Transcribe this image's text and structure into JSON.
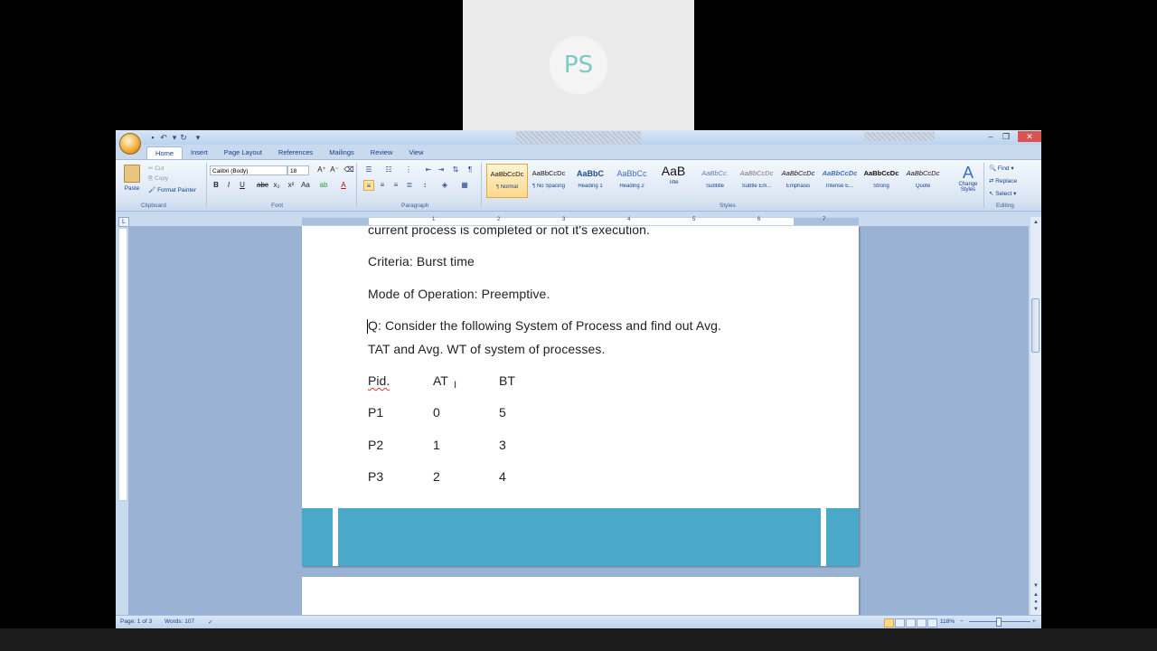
{
  "avatar": {
    "initials": "PS"
  },
  "window": {
    "tabs": [
      "Home",
      "Insert",
      "Page Layout",
      "References",
      "Mailings",
      "Review",
      "View"
    ],
    "clipboard": {
      "paste": "Paste",
      "cut": "Cut",
      "copy": "Copy",
      "format_painter": "Format Painter",
      "label": "Clipboard"
    },
    "font": {
      "name": "Calibri (Body)",
      "size": "18",
      "label": "Font"
    },
    "paragraph": {
      "label": "Paragraph"
    },
    "styles": {
      "label": "Styles",
      "items": [
        {
          "sample": "AaBbCcDc",
          "name": "¶ Normal"
        },
        {
          "sample": "AaBbCcDc",
          "name": "¶ No Spacing"
        },
        {
          "sample": "AaBbC",
          "name": "Heading 1"
        },
        {
          "sample": "AaBbCc",
          "name": "Heading 2"
        },
        {
          "sample": "AaB",
          "name": "Title"
        },
        {
          "sample": "AaBbCc.",
          "name": "Subtitle"
        },
        {
          "sample": "AaBbCcDc",
          "name": "Subtle Em..."
        },
        {
          "sample": "AaBbCcDc",
          "name": "Emphasis"
        },
        {
          "sample": "AaBbCcDc",
          "name": "Intense E..."
        },
        {
          "sample": "AaBbCcDc",
          "name": "Strong"
        },
        {
          "sample": "AaBbCcDc",
          "name": "Quote"
        }
      ],
      "change_styles": "Change Styles"
    },
    "editing": {
      "find": "Find",
      "replace": "Replace",
      "select": "Select",
      "label": "Editing"
    }
  },
  "ruler": {
    "numbers": [
      "1",
      "2",
      "3",
      "4",
      "5",
      "6",
      "7"
    ]
  },
  "document": {
    "line_top": "current process is completed or not it's execution.",
    "criteria": "Criteria: Burst time",
    "mode": "Mode of Operation: Preemptive.",
    "question_1": "Q: Consider the following System of Process and find out Avg.",
    "question_2": "TAT and Avg. WT of system of processes.",
    "table": {
      "headers": [
        "Pid.",
        "AT",
        "BT"
      ],
      "rows": [
        [
          "P1",
          "0",
          "5"
        ],
        [
          "P2",
          "1",
          "3"
        ],
        [
          "P3",
          "2",
          "4"
        ]
      ]
    }
  },
  "statusbar": {
    "page": "Page: 1 of 3",
    "words": "Words: 107",
    "zoom": "118%"
  },
  "colors": {
    "page_band": "#4aa8c8",
    "ribbon_text": "#15428b",
    "close": "#d9534f"
  }
}
